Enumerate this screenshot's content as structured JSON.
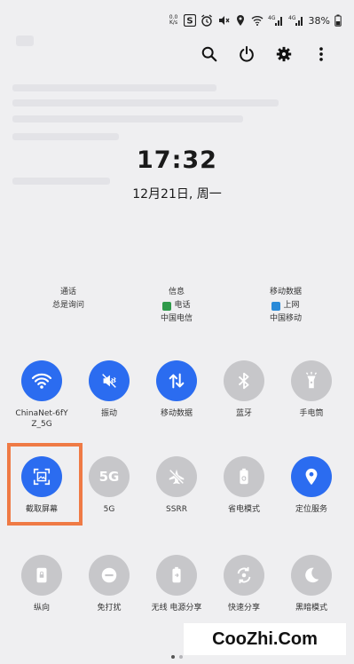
{
  "status_bar": {
    "net_speed": "0.0 K/s",
    "app_icon_text": "S",
    "signal_1": "4G",
    "signal_2": "4G",
    "battery": "38%"
  },
  "top_actions": [
    "search-icon",
    "power-icon",
    "gear-icon",
    "more-vert-icon"
  ],
  "clock": "17:32",
  "date": "12月21日, 周一",
  "carriers": [
    {
      "title": "通话",
      "line1": "总是询问",
      "line2": ""
    },
    {
      "title": "信息",
      "line1": "电话",
      "line2": "中国电信",
      "chip_color": "#2e9a4a"
    },
    {
      "title": "移动数据",
      "line1": "上网",
      "line2": "中国移动",
      "chip_color": "#2a8ad8"
    }
  ],
  "tiles": [
    {
      "label": "ChinaNet-6fY Z_5G",
      "icon": "wifi-icon",
      "on": true
    },
    {
      "label": "振动",
      "icon": "vibrate-icon",
      "on": true
    },
    {
      "label": "移动数据",
      "icon": "mobile-data-icon",
      "on": true
    },
    {
      "label": "蓝牙",
      "icon": "bluetooth-icon",
      "on": false
    },
    {
      "label": "手电筒",
      "icon": "flashlight-icon",
      "on": false
    },
    {
      "label": "截取屏幕",
      "icon": "screenshot-icon",
      "on": true
    },
    {
      "label": "5G",
      "icon": "5g-icon",
      "on": false,
      "icon_text": "5G"
    },
    {
      "label": "SSRR",
      "icon": "airplane-off-icon",
      "on": false
    },
    {
      "label": "省电模式",
      "icon": "battery-saver-icon",
      "on": false
    },
    {
      "label": "定位服务",
      "icon": "location-icon",
      "on": true
    },
    {
      "label": "纵向",
      "icon": "portrait-lock-icon",
      "on": false
    },
    {
      "label": "免打扰",
      "icon": "dnd-icon",
      "on": false
    },
    {
      "label": "无线 电源分享",
      "icon": "wireless-powershare-icon",
      "on": false
    },
    {
      "label": "快速分享",
      "icon": "quick-share-icon",
      "on": false
    },
    {
      "label": "黑暗模式",
      "icon": "dark-mode-icon",
      "on": false
    }
  ],
  "watermark": "CooZhi.Com",
  "colors": {
    "accent": "#2b6cf0",
    "tile_off": "#c7c7ca",
    "highlight": "#ef7a45"
  }
}
